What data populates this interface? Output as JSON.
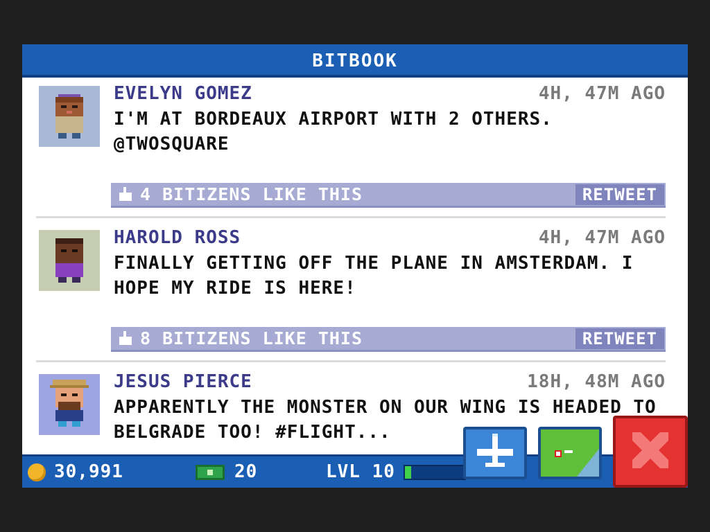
{
  "title": "BITBOOK",
  "posts": [
    {
      "author": "EVELYN GOMEZ",
      "time": "4H, 47M AGO",
      "message": "I'M AT BORDEAUX AIRPORT WITH 2 OTHERS. @TWOSQUARE",
      "likes": "4 BITIZENS LIKE THIS",
      "retweet": "RETWEET"
    },
    {
      "author": "HAROLD ROSS",
      "time": "4H, 47M AGO",
      "message": "FINALLY GETTING OFF THE PLANE IN AMSTERDAM. I HOPE MY RIDE IS HERE!",
      "likes": "8 BITIZENS LIKE THIS",
      "retweet": "RETWEET"
    },
    {
      "author": "JESUS PIERCE",
      "time": "18H, 48M AGO",
      "message": "APPARENTLY THE MONSTER ON OUR WING IS HEADED TO BELGRADE TOO! #FLIGHT...",
      "likes": "",
      "retweet": ""
    }
  ],
  "status": {
    "coins": "30,991",
    "bux": "20",
    "level": "LVL 10",
    "level_progress": 0.1
  },
  "colors": {
    "header_blue": "#1b5fb4",
    "like_bar": "#a7abd3",
    "close_red": "#e43131",
    "map_green": "#5fbf3a"
  },
  "icons": {
    "coin": "coin-icon",
    "bux": "bux-icon",
    "like": "thumbs-up-icon",
    "flight": "airplane-icon",
    "map": "map-icon",
    "close": "close-icon"
  }
}
